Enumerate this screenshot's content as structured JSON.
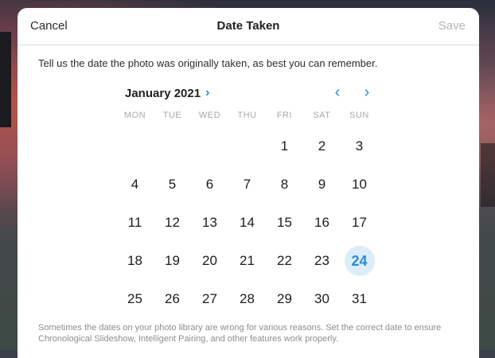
{
  "header": {
    "cancel_label": "Cancel",
    "title": "Date Taken",
    "save_label": "Save"
  },
  "intro": "Tell us the date the photo was originally taken, as best you can remember.",
  "calendar": {
    "month_label": "January 2021",
    "month_chevron": "›",
    "prev_arrow": "‹",
    "next_arrow": "›",
    "weekdays": [
      "MON",
      "TUE",
      "WED",
      "THU",
      "FRI",
      "SAT",
      "SUN"
    ],
    "weeks": [
      [
        "",
        "",
        "",
        "",
        "1",
        "2",
        "3"
      ],
      [
        "4",
        "5",
        "6",
        "7",
        "8",
        "9",
        "10"
      ],
      [
        "11",
        "12",
        "13",
        "14",
        "15",
        "16",
        "17"
      ],
      [
        "18",
        "19",
        "20",
        "21",
        "22",
        "23",
        "24"
      ],
      [
        "25",
        "26",
        "27",
        "28",
        "29",
        "30",
        "31"
      ]
    ],
    "selected_day": "24",
    "accent_color": "#2b8ed6"
  },
  "note": "Sometimes the dates on your photo library are wrong for various reasons. Set the correct date to ensure Chronological Slideshow, Intelligent Pairing, and other features work properly."
}
